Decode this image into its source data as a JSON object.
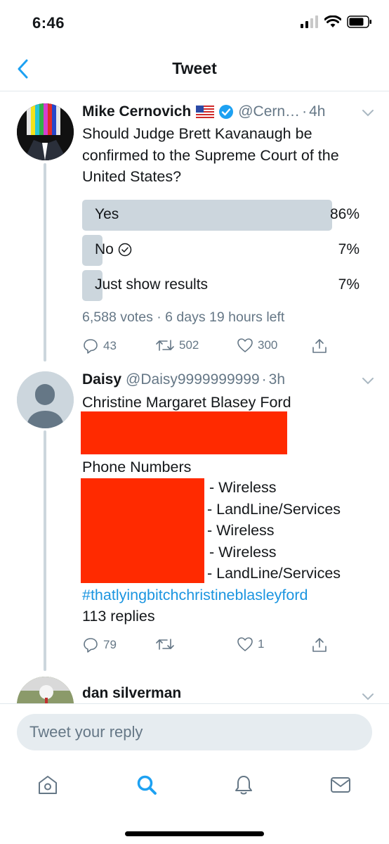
{
  "status_bar": {
    "time": "6:46"
  },
  "nav": {
    "title": "Tweet"
  },
  "tweets": [
    {
      "name": "Mike Cernovich",
      "handle": "@Cern…",
      "time": "4h",
      "text": "Should Judge Brett Kavanaugh be confirmed to the Supreme Court of the United States?",
      "poll": {
        "options": [
          {
            "label": "Yes",
            "percent": "86%",
            "fraction": 0.86
          },
          {
            "label": "No",
            "percent": "7%",
            "fraction": 0.07
          },
          {
            "label": "Just show results",
            "percent": "7%",
            "fraction": 0.07
          }
        ],
        "meta": "6,588 votes · 6 days 19 hours left"
      },
      "actions": {
        "replies": "43",
        "retweets": "502",
        "likes": "300"
      }
    },
    {
      "name": "Daisy",
      "handle": "@Daisy9999999999",
      "time": "3h",
      "line1": "Christine Margaret Blasey Ford",
      "phone_heading": "Phone Numbers",
      "phone_types": [
        "- Wireless",
        "- LandLine/Services",
        "- Wireless",
        "- Wireless",
        "- LandLine/Services"
      ],
      "hashtag": "#thatlyingbitchchristineblasleyford",
      "replies_text": "113 replies",
      "actions": {
        "replies": "79",
        "retweets": "",
        "likes": "1"
      }
    },
    {
      "name": "dan silverman"
    }
  ],
  "reply": {
    "placeholder": "Tweet your reply"
  },
  "colors": {
    "accent": "#1da1f2",
    "poll_bar": "#ccd6dd",
    "redaction": "#ff2a00",
    "muted": "#657786"
  }
}
